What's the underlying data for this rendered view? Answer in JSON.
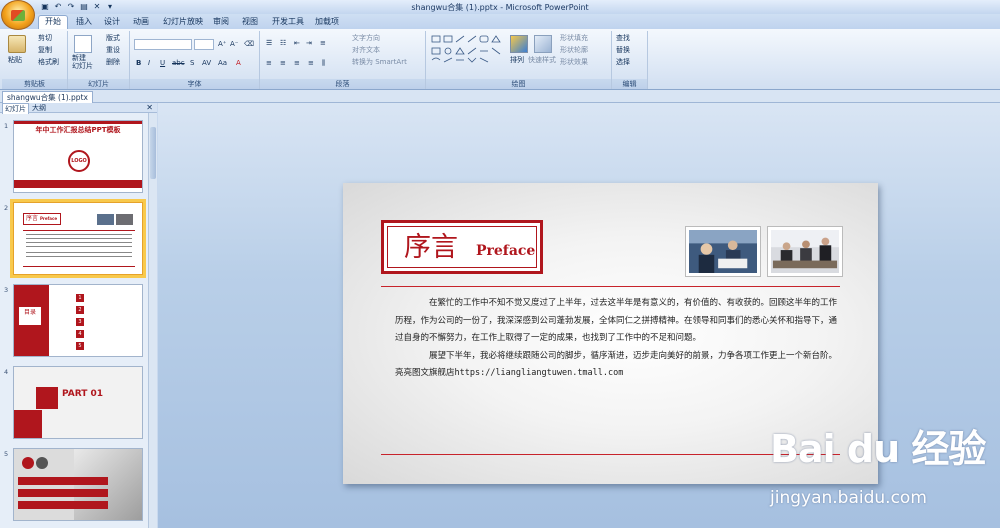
{
  "window": {
    "title": "shangwu合集 (1).pptx - Microsoft PowerPoint"
  },
  "ribbon_tabs": [
    "开始",
    "插入",
    "设计",
    "动画",
    "幻灯片放映",
    "审阅",
    "视图",
    "开发工具",
    "加载项"
  ],
  "clipboard": {
    "cut": "剪切",
    "copy": "复制",
    "format_painter": "格式刷",
    "paste": "粘贴",
    "label": "剪贴板"
  },
  "slides_group": {
    "new_slide": "新建\n幻灯片",
    "layout": "版式",
    "reset": "重设",
    "delete": "删除",
    "label": "幻灯片"
  },
  "font_group": {
    "label": "字体"
  },
  "paragraph_group": {
    "text_direction": "文字方向",
    "align_text": "对齐文本",
    "convert_smartart": "转换为 SmartArt",
    "label": "段落"
  },
  "drawing_group": {
    "arrange": "排列",
    "quick_styles": "快速样式",
    "shape_fill": "形状填充",
    "shape_outline": "形状轮廓",
    "shape_effects": "形状效果",
    "label": "绘图"
  },
  "editing_group": {
    "find": "查找",
    "replace": "替换",
    "select": "选择",
    "label": "编辑"
  },
  "doc_tab": "shangwu合集 (1).pptx",
  "panel": {
    "tab_slides": "幻灯片",
    "tab_outline": "大纲"
  },
  "thumbnails": [
    {
      "num": "1",
      "title": "年中工作汇报总结PPT模板",
      "logo": "LOGO"
    },
    {
      "num": "2",
      "title": "序言",
      "sub": "Preface"
    },
    {
      "num": "3",
      "title": "目录",
      "items": [
        "1",
        "2",
        "3",
        "4",
        "5"
      ]
    },
    {
      "num": "4",
      "title": "PART 01"
    },
    {
      "num": "5"
    }
  ],
  "slide": {
    "title_cn": "序言",
    "title_en": "Preface",
    "para1": "在繁忙的工作中不知不觉又度过了上半年，过去这半年是有意义的，有价值的、有收获的。回顾这半年的工作历程，作为公司的一份了，我深深感到公司蓬勃发展，全体同仁之拼搏精神。在领导和同事们的悉心关怀和指导下，通过自身的不懈努力，在工作上取得了一定的成果，也找到了工作中的不足和问题。",
    "para2": "展望下半年，我必将继续跟随公司的脚步，循序渐进，迈步走向美好的前景，力争各项工作更上一个新台阶。",
    "store": "亮亮图文旗舰店https://liangliangtuwen.tmall.com"
  },
  "watermark": {
    "logo": "Bai du 经验",
    "url": "jingyan.baidu.com"
  },
  "colors": {
    "accent": "#b0161d",
    "ribbon": "#dfe9f6"
  }
}
